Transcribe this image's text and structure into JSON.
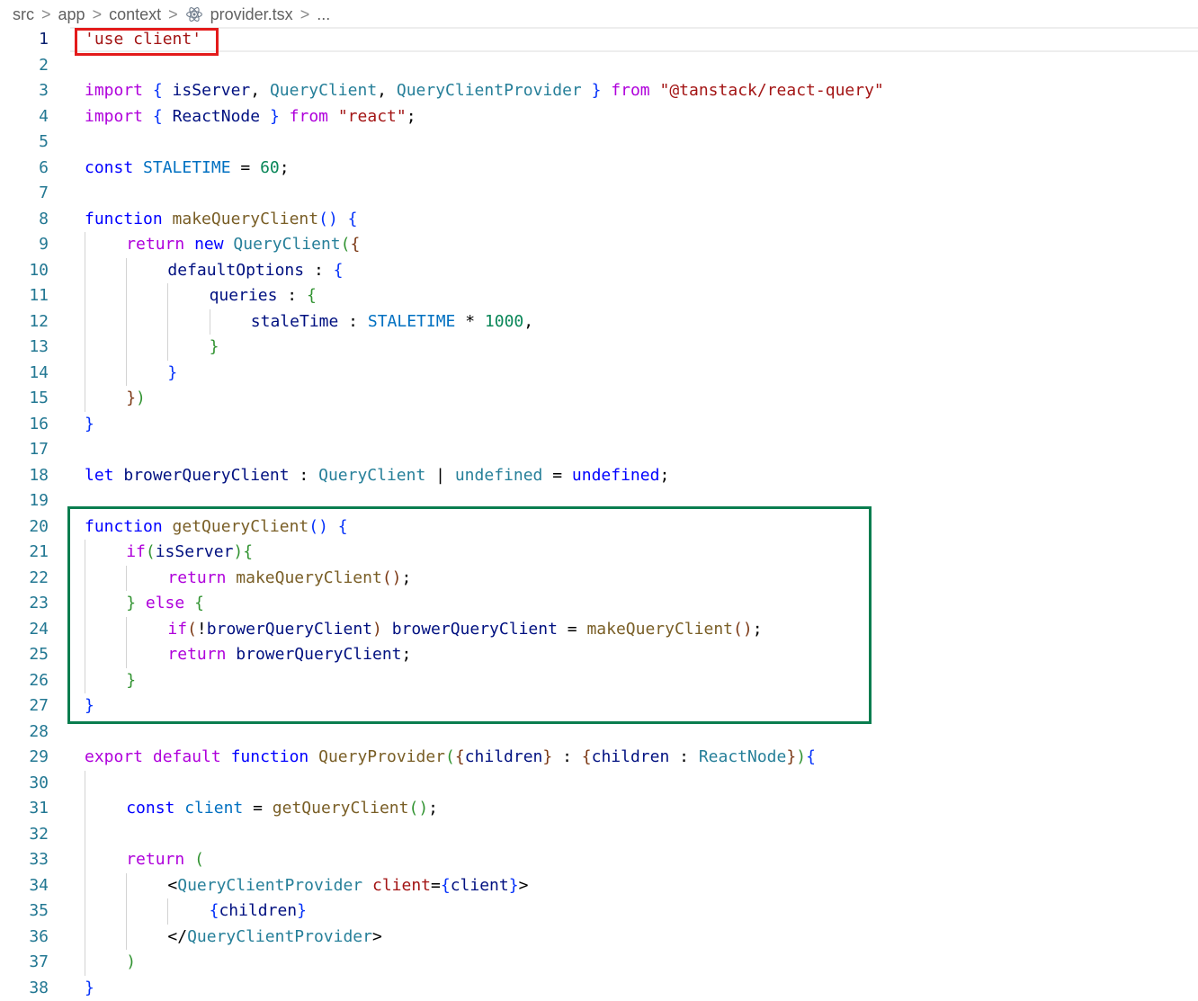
{
  "breadcrumb": {
    "items": [
      "src",
      "app",
      "context",
      "provider.tsx",
      "..."
    ],
    "separator": ">"
  },
  "file_icon": "react-icon",
  "colors": {
    "keyword": "#0000ff",
    "control": "#af00db",
    "string": "#a31515",
    "number": "#098658",
    "function": "#795e26",
    "type": "#267f99",
    "variable": "#001080",
    "constant": "#0070c1",
    "highlight_red": "#e31b1b",
    "highlight_green": "#0a7d4f"
  },
  "editor": {
    "active_line": 1,
    "lines": [
      {
        "num": "1",
        "indent": 0,
        "tokens": [
          [
            "s",
            "'use client'"
          ]
        ]
      },
      {
        "num": "2",
        "indent": 0,
        "tokens": []
      },
      {
        "num": "3",
        "indent": 0,
        "tokens": [
          [
            "c",
            "import"
          ],
          [
            "p",
            " "
          ],
          [
            "b1",
            "{"
          ],
          [
            "v",
            " isServer"
          ],
          [
            "p",
            ", "
          ],
          [
            "t",
            "QueryClient"
          ],
          [
            "p",
            ", "
          ],
          [
            "t",
            "QueryClientProvider"
          ],
          [
            "p",
            " "
          ],
          [
            "b1",
            "}"
          ],
          [
            "p",
            " "
          ],
          [
            "c",
            "from"
          ],
          [
            "p",
            " "
          ],
          [
            "s",
            "\"@tanstack/react-query\""
          ]
        ]
      },
      {
        "num": "4",
        "indent": 0,
        "tokens": [
          [
            "c",
            "import"
          ],
          [
            "p",
            " "
          ],
          [
            "b1",
            "{"
          ],
          [
            "p",
            " "
          ],
          [
            "v",
            "ReactNode"
          ],
          [
            "p",
            " "
          ],
          [
            "b1",
            "}"
          ],
          [
            "p",
            " "
          ],
          [
            "c",
            "from"
          ],
          [
            "p",
            " "
          ],
          [
            "s",
            "\"react\""
          ],
          [
            "p",
            ";"
          ]
        ]
      },
      {
        "num": "5",
        "indent": 0,
        "tokens": []
      },
      {
        "num": "6",
        "indent": 0,
        "tokens": [
          [
            "k",
            "const"
          ],
          [
            "p",
            " "
          ],
          [
            "cst",
            "STALETIME"
          ],
          [
            "p",
            " = "
          ],
          [
            "n",
            "60"
          ],
          [
            "p",
            ";"
          ]
        ]
      },
      {
        "num": "7",
        "indent": 0,
        "tokens": []
      },
      {
        "num": "8",
        "indent": 0,
        "tokens": [
          [
            "k",
            "function"
          ],
          [
            "p",
            " "
          ],
          [
            "f",
            "makeQueryClient"
          ],
          [
            "b1",
            "()"
          ],
          [
            "p",
            " "
          ],
          [
            "b1",
            "{"
          ]
        ]
      },
      {
        "num": "9",
        "indent": 1,
        "tokens": [
          [
            "c",
            "return"
          ],
          [
            "p",
            " "
          ],
          [
            "k",
            "new"
          ],
          [
            "p",
            " "
          ],
          [
            "t",
            "QueryClient"
          ],
          [
            "b2",
            "("
          ],
          [
            "b3",
            "{"
          ]
        ]
      },
      {
        "num": "10",
        "indent": 2,
        "tokens": [
          [
            "v",
            "defaultOptions"
          ],
          [
            "p",
            " : "
          ],
          [
            "b1",
            "{"
          ]
        ]
      },
      {
        "num": "11",
        "indent": 3,
        "tokens": [
          [
            "v",
            "queries"
          ],
          [
            "p",
            " : "
          ],
          [
            "b2",
            "{"
          ]
        ]
      },
      {
        "num": "12",
        "indent": 4,
        "tokens": [
          [
            "v",
            "staleTime"
          ],
          [
            "p",
            " : "
          ],
          [
            "cst",
            "STALETIME"
          ],
          [
            "p",
            " * "
          ],
          [
            "n",
            "1000"
          ],
          [
            "p",
            ","
          ]
        ]
      },
      {
        "num": "13",
        "indent": 3,
        "tokens": [
          [
            "b2",
            "}"
          ]
        ]
      },
      {
        "num": "14",
        "indent": 2,
        "tokens": [
          [
            "b1",
            "}"
          ]
        ]
      },
      {
        "num": "15",
        "indent": 1,
        "tokens": [
          [
            "b3",
            "}"
          ],
          [
            "b2",
            ")"
          ]
        ]
      },
      {
        "num": "16",
        "indent": 0,
        "tokens": [
          [
            "b1",
            "}"
          ]
        ]
      },
      {
        "num": "17",
        "indent": 0,
        "tokens": []
      },
      {
        "num": "18",
        "indent": 0,
        "tokens": [
          [
            "k",
            "let"
          ],
          [
            "p",
            " "
          ],
          [
            "v",
            "browerQueryClient"
          ],
          [
            "p",
            " : "
          ],
          [
            "t",
            "QueryClient"
          ],
          [
            "p",
            " | "
          ],
          [
            "t",
            "undefined"
          ],
          [
            "p",
            " = "
          ],
          [
            "k",
            "undefined"
          ],
          [
            "p",
            ";"
          ]
        ]
      },
      {
        "num": "19",
        "indent": 0,
        "tokens": []
      },
      {
        "num": "20",
        "indent": 0,
        "tokens": [
          [
            "k",
            "function"
          ],
          [
            "p",
            " "
          ],
          [
            "f",
            "getQueryClient"
          ],
          [
            "b1",
            "()"
          ],
          [
            "p",
            " "
          ],
          [
            "b1",
            "{"
          ]
        ]
      },
      {
        "num": "21",
        "indent": 1,
        "tokens": [
          [
            "c",
            "if"
          ],
          [
            "b2",
            "("
          ],
          [
            "v",
            "isServer"
          ],
          [
            "b2",
            ")"
          ],
          [
            "b2",
            "{"
          ]
        ]
      },
      {
        "num": "22",
        "indent": 2,
        "tokens": [
          [
            "c",
            "return"
          ],
          [
            "p",
            " "
          ],
          [
            "f",
            "makeQueryClient"
          ],
          [
            "b3",
            "()"
          ],
          [
            "p",
            ";"
          ]
        ]
      },
      {
        "num": "23",
        "indent": 1,
        "tokens": [
          [
            "b2",
            "}"
          ],
          [
            "p",
            " "
          ],
          [
            "c",
            "else"
          ],
          [
            "p",
            " "
          ],
          [
            "b2",
            "{"
          ]
        ]
      },
      {
        "num": "24",
        "indent": 2,
        "tokens": [
          [
            "c",
            "if"
          ],
          [
            "b3",
            "("
          ],
          [
            "p",
            "!"
          ],
          [
            "v",
            "browerQueryClient"
          ],
          [
            "b3",
            ")"
          ],
          [
            "p",
            " "
          ],
          [
            "v",
            "browerQueryClient"
          ],
          [
            "p",
            " = "
          ],
          [
            "f",
            "makeQueryClient"
          ],
          [
            "b3",
            "()"
          ],
          [
            "p",
            ";"
          ]
        ]
      },
      {
        "num": "25",
        "indent": 2,
        "tokens": [
          [
            "c",
            "return"
          ],
          [
            "p",
            " "
          ],
          [
            "v",
            "browerQueryClient"
          ],
          [
            "p",
            ";"
          ]
        ]
      },
      {
        "num": "26",
        "indent": 1,
        "tokens": [
          [
            "b2",
            "}"
          ]
        ]
      },
      {
        "num": "27",
        "indent": 0,
        "tokens": [
          [
            "b1",
            "}"
          ]
        ]
      },
      {
        "num": "28",
        "indent": 0,
        "tokens": []
      },
      {
        "num": "29",
        "indent": 0,
        "tokens": [
          [
            "c",
            "export"
          ],
          [
            "p",
            " "
          ],
          [
            "c",
            "default"
          ],
          [
            "p",
            " "
          ],
          [
            "k",
            "function"
          ],
          [
            "p",
            " "
          ],
          [
            "f",
            "QueryProvider"
          ],
          [
            "b2",
            "("
          ],
          [
            "b3",
            "{"
          ],
          [
            "v",
            "children"
          ],
          [
            "b3",
            "}"
          ],
          [
            "p",
            " : "
          ],
          [
            "b3",
            "{"
          ],
          [
            "v",
            "children"
          ],
          [
            "p",
            " : "
          ],
          [
            "t",
            "ReactNode"
          ],
          [
            "b3",
            "}"
          ],
          [
            "b2",
            ")"
          ],
          [
            "b1",
            "{"
          ]
        ]
      },
      {
        "num": "30",
        "indent": 0,
        "tokens": []
      },
      {
        "num": "31",
        "indent": 1,
        "tokens": [
          [
            "k",
            "const"
          ],
          [
            "p",
            " "
          ],
          [
            "cst",
            "client"
          ],
          [
            "p",
            " = "
          ],
          [
            "f",
            "getQueryClient"
          ],
          [
            "b2",
            "()"
          ],
          [
            "p",
            ";"
          ]
        ]
      },
      {
        "num": "32",
        "indent": 0,
        "tokens": []
      },
      {
        "num": "33",
        "indent": 1,
        "tokens": [
          [
            "c",
            "return"
          ],
          [
            "p",
            " "
          ],
          [
            "b2",
            "("
          ]
        ]
      },
      {
        "num": "34",
        "indent": 2,
        "tokens": [
          [
            "p",
            "<"
          ],
          [
            "t",
            "QueryClientProvider"
          ],
          [
            "p",
            " "
          ],
          [
            "s",
            "client"
          ],
          [
            "p",
            "="
          ],
          [
            "b1",
            "{"
          ],
          [
            "v",
            "client"
          ],
          [
            "b1",
            "}"
          ],
          [
            "p",
            ">"
          ]
        ]
      },
      {
        "num": "35",
        "indent": 3,
        "tokens": [
          [
            "b1",
            "{"
          ],
          [
            "v",
            "children"
          ],
          [
            "b1",
            "}"
          ]
        ]
      },
      {
        "num": "36",
        "indent": 2,
        "tokens": [
          [
            "p",
            "</"
          ],
          [
            "t",
            "QueryClientProvider"
          ],
          [
            "p",
            ">"
          ]
        ]
      },
      {
        "num": "37",
        "indent": 1,
        "tokens": [
          [
            "b2",
            ")"
          ]
        ]
      },
      {
        "num": "38",
        "indent": 0,
        "tokens": [
          [
            "b1",
            "}"
          ]
        ]
      }
    ]
  }
}
